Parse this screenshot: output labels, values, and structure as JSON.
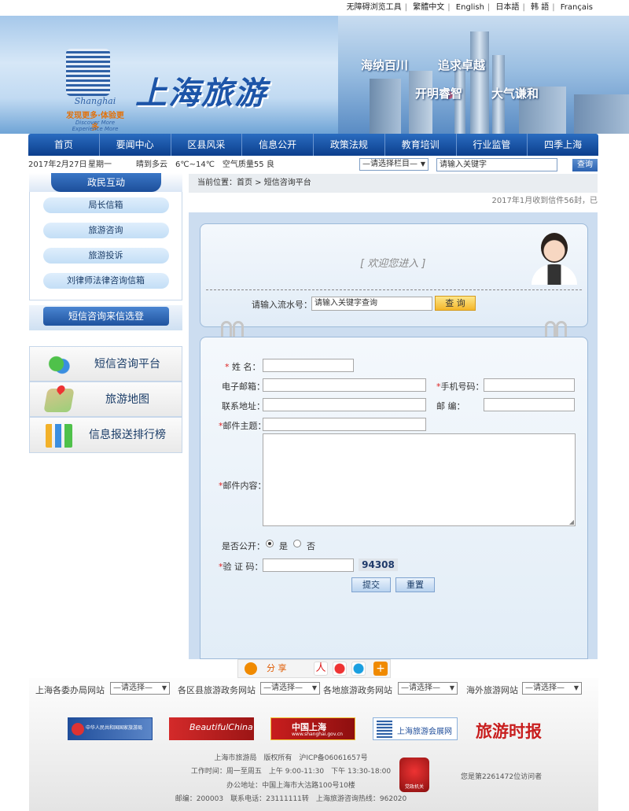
{
  "topbar": {
    "links": [
      "无障碍浏览工具",
      "繁體中文",
      "English",
      "日本語",
      "韩 語",
      "Français"
    ]
  },
  "banner": {
    "logo_script": "Shanghai",
    "logo_tagline_cn": "发现更多·体验更多",
    "logo_tagline_en": "Discover More Experience More",
    "title": "上海旅游",
    "slogans": [
      "海纳百川",
      "追求卓越",
      "开明睿智",
      "大气谦和"
    ]
  },
  "nav": {
    "items": [
      "首页",
      "要闻中心",
      "区县风采",
      "信息公开",
      "政策法规",
      "教育培训",
      "行业监管",
      "四季上海"
    ]
  },
  "infobar": {
    "date": "2017年2月27日",
    "weekday": "星期一",
    "weather": "晴到多云　6℃~14℃　空气质量55 良",
    "column_select": "—请选择栏目—",
    "keyword": "请输入关键字",
    "search_button": "查询"
  },
  "sidebar": {
    "section1_title": "政民互动",
    "links": [
      "局长信箱",
      "旅游咨询",
      "旅游投诉",
      "刘律师法律咨询信箱"
    ],
    "section2_title": "短信咨询来信选登",
    "features": [
      {
        "label": "短信咨询平台",
        "icon": "chat-bubble-icon"
      },
      {
        "label": "旅游地图",
        "icon": "map-icon"
      },
      {
        "label": "信息报送排行榜",
        "icon": "ranking-icon"
      }
    ]
  },
  "main": {
    "breadcrumb": "当前位置：首页 > 短信咨询平台",
    "notice": "2017年1月收到信件56封，已",
    "welcome": "[ 欢迎您进入 ]",
    "serial_label": "请输入流水号：",
    "serial_value": "请输入关键字查询",
    "serial_button": "查 询",
    "form": {
      "name_label": "姓  名：",
      "email_label": "电子邮箱：",
      "mobile_label": "手机号码：",
      "address_label": "联系地址：",
      "zip_label": "邮  编：",
      "subject_label": "邮件主题：",
      "content_label": "邮件内容：",
      "public_label": "是否公开：",
      "public_yes": "是",
      "public_no": "否",
      "captcha_label": "验 证 码：",
      "captcha_value": "94308",
      "submit": "提交",
      "reset": "重置",
      "required_mark": "*"
    }
  },
  "share": {
    "label": "分 享"
  },
  "footer": {
    "link_groups": [
      {
        "label": "上海各委办局网站",
        "select": "—请选择—"
      },
      {
        "label": "各区县旅游政务网站",
        "select": "—请选择—"
      },
      {
        "label": "各地旅游政务网站",
        "select": "—请选择—"
      },
      {
        "label": "海外旅游网站",
        "select": "—请选择—"
      }
    ],
    "banners": [
      "中华人民共和国国家旅游局",
      "BeautifulChina",
      "中国上海",
      "上海旅游会展网",
      "旅游时报"
    ],
    "banner_sub": "www.shanghai.gov.cn",
    "copyright": "上海市旅游局　版权所有　沪ICP备06061657号",
    "hours": "工作时间：周一至周五　上午 9:00-11:30　下午 13:30-18:00",
    "address": "办公地址：中国上海市大沽路100号10楼",
    "contact": "邮编：200003　联系电话：23111111转　上海旅游咨询热线：962020",
    "badge": "党政机关",
    "visits": "您是第2261472位访问者"
  },
  "colors": {
    "nav_blue": "#0c3f8d",
    "panel_blue": "#ccddf0",
    "accent_orange": "#f4b62a",
    "required_red": "#dd2222"
  }
}
